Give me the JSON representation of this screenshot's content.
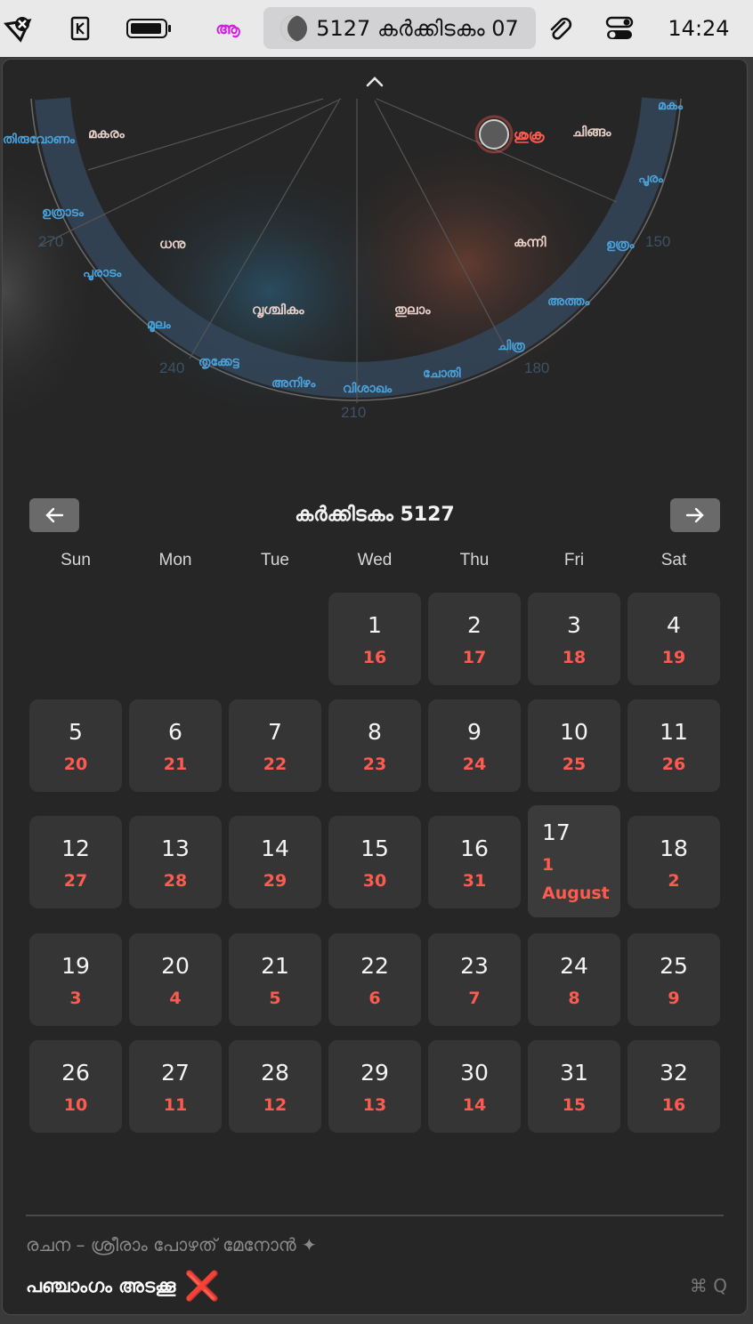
{
  "menubar": {
    "app_status": "5127 കർക്കിടകം 07",
    "time": "14:24",
    "malayalam_glyph": "ആ"
  },
  "wheel": {
    "rasi": [
      "മകരം",
      "ചിങ്ങം",
      "ധനു",
      "കന്നി",
      "വൃശ്ചികം",
      "തുലാം"
    ],
    "nakshatras": [
      "തിരുവോണം",
      "ഉത്രാടം",
      "പൂരാടം",
      "മൂലം",
      "തൃക്കേട്ട",
      "അനിഴം",
      "വിശാഖം",
      "ചോതി",
      "ചിത്ര",
      "അത്തം",
      "ഉത്രം",
      "പൂരം",
      "മകം"
    ],
    "planet": "ശുക്ര",
    "degrees": [
      "270",
      "240",
      "210",
      "180",
      "150"
    ]
  },
  "calendar": {
    "title": "കർക്കിടകം 5127",
    "weekdays": [
      "Sun",
      "Mon",
      "Tue",
      "Wed",
      "Thu",
      "Fri",
      "Sat"
    ],
    "weeks": [
      [
        null,
        null,
        null,
        {
          "d": "1",
          "g": "16"
        },
        {
          "d": "2",
          "g": "17"
        },
        {
          "d": "3",
          "g": "18"
        },
        {
          "d": "4",
          "g": "19"
        }
      ],
      [
        {
          "d": "5",
          "g": "20"
        },
        {
          "d": "6",
          "g": "21"
        },
        {
          "d": "7",
          "g": "22"
        },
        {
          "d": "8",
          "g": "23"
        },
        {
          "d": "9",
          "g": "24"
        },
        {
          "d": "10",
          "g": "25"
        },
        {
          "d": "11",
          "g": "26"
        }
      ],
      [
        {
          "d": "12",
          "g": "27"
        },
        {
          "d": "13",
          "g": "28"
        },
        {
          "d": "14",
          "g": "29"
        },
        {
          "d": "15",
          "g": "30"
        },
        {
          "d": "16",
          "g": "31"
        },
        {
          "d": "17",
          "g": "1",
          "m": "August"
        },
        {
          "d": "18",
          "g": "2"
        }
      ],
      [
        {
          "d": "19",
          "g": "3"
        },
        {
          "d": "20",
          "g": "4"
        },
        {
          "d": "21",
          "g": "5"
        },
        {
          "d": "22",
          "g": "6"
        },
        {
          "d": "23",
          "g": "7"
        },
        {
          "d": "24",
          "g": "8"
        },
        {
          "d": "25",
          "g": "9"
        }
      ],
      [
        {
          "d": "26",
          "g": "10"
        },
        {
          "d": "27",
          "g": "11"
        },
        {
          "d": "28",
          "g": "12"
        },
        {
          "d": "29",
          "g": "13"
        },
        {
          "d": "30",
          "g": "14"
        },
        {
          "d": "31",
          "g": "15"
        },
        {
          "d": "32",
          "g": "16"
        }
      ]
    ]
  },
  "footer": {
    "credit": "രചന – ശ്രീരാം പോഴത് മേനോൻ ✦",
    "close_label": "പഞ്ചാംഗം അടക്കൂ",
    "close_icon": "❌",
    "shortcut": "⌘ Q"
  },
  "colors": {
    "accent_red": "#ff5a4f",
    "label_blue": "#4aa3dc",
    "label_light": "#e8d0c8"
  }
}
